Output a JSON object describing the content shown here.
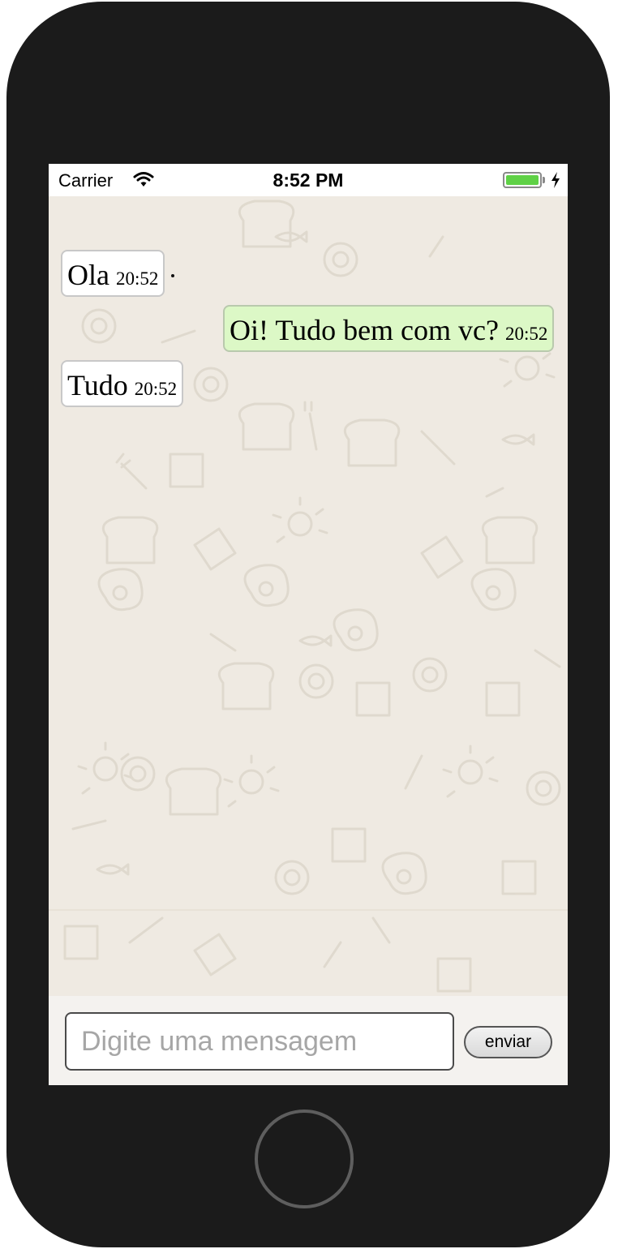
{
  "status_bar": {
    "carrier": "Carrier",
    "time": "8:52 PM",
    "battery_color": "#5fd146",
    "icons": [
      "wifi-icon",
      "battery-icon",
      "charging-bolt-icon"
    ]
  },
  "chat": {
    "background_color": "#efeae2",
    "messages": [
      {
        "direction": "received",
        "text": "Ola",
        "time": "20:52"
      },
      {
        "direction": "sent",
        "text": "Oi! Tudo bem com vc?",
        "time": "20:52"
      },
      {
        "direction": "received",
        "text": "Tudo",
        "time": "20:52"
      }
    ],
    "received_bubble_color": "#ffffff",
    "sent_bubble_color": "#dcf8c6"
  },
  "composer": {
    "placeholder": "Digite uma mensagem",
    "value": "",
    "send_label": "enviar"
  }
}
